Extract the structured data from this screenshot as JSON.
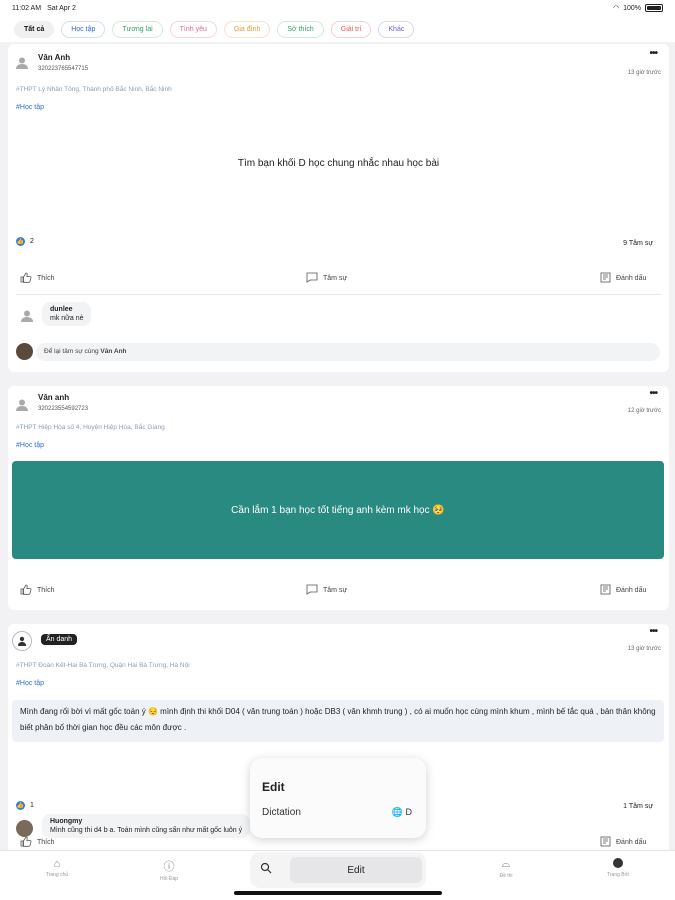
{
  "status_bar": {
    "time": "11:02 AM",
    "date": "Sat Apr 2",
    "battery": "100%"
  },
  "tabs": [
    {
      "label": "Tất cả",
      "color": "#111111",
      "border": "#f0f0f0"
    },
    {
      "label": "Học tập",
      "color": "#2f6fd8",
      "border": "#cfe0f7"
    },
    {
      "label": "Tương lai",
      "color": "#2e9f63",
      "border": "#cdeed9"
    },
    {
      "label": "Tình yêu",
      "color": "#e36b8a",
      "border": "#f6d5dd"
    },
    {
      "label": "Gia đình",
      "color": "#e39a3b",
      "border": "#f6e3c9"
    },
    {
      "label": "Sở thích",
      "color": "#2e9f63",
      "border": "#cdeed9"
    },
    {
      "label": "Giải trí",
      "color": "#e05a5a",
      "border": "#f6d0d0"
    },
    {
      "label": "Khác",
      "color": "#6a5ad8",
      "border": "#dcd7f6"
    }
  ],
  "posts": [
    {
      "name": "Vân Anh",
      "uid": "320223765547715",
      "time": "13 giờ trước",
      "school": "#THPT Lý Nhân Tông, Thành phố Bắc Ninh, Bắc Ninh",
      "tag": "#Học tập",
      "content": "Tìm bạn khối D học chung nhắc nhau học bài",
      "likes": "2",
      "shares": "9 Tâm sự",
      "comment_name": "dunlee",
      "comment_text": "mk nữa nè",
      "reply_placeholder": "Để lại tâm sự cùng",
      "reply_name": "Vân Anh"
    },
    {
      "name": "Vân anh",
      "uid": "320223554592723",
      "time": "12 giờ trước",
      "school": "#THPT Hiệp Hòa số 4, Huyện Hiệp Hòa, Bắc Giang",
      "tag": "#Học tập",
      "content": "Cần lắm 1 bạn học tốt tiếng anh kèm mk học 🥺",
      "box_color": "#288a80"
    },
    {
      "badge": "Ẩn danh",
      "time": "13 giờ trước",
      "school": "#THPT Đoàn Kết-Hai Bà Trưng, Quận Hai Bà Trưng, Hà Nội",
      "tag": "#Học tập",
      "content": "Mình đang rối bời vì mất gốc toán ý 😔 mình định thi khối D04 ( văn trung toán ) hoặc DB3 ( văn khmh trung ) , có ai muốn học cùng mình khum , mình bế tắc quá , bản thân không biết phân bố thời gian học đều các môn được .",
      "likes": "1",
      "shares": "1 Tâm sự",
      "comment_name": "Huongmy",
      "comment_text": "Mình cũng thi d4 b a. Toán mình cũng sẩn như mất gốc luôn ý"
    }
  ],
  "actions": {
    "like": "Thích",
    "comment": "Tâm sự",
    "bookmark": "Đánh dấu"
  },
  "bottom_nav": [
    {
      "label": "Trang chủ",
      "icon": "home-icon"
    },
    {
      "label": "Hỏi Đáp",
      "icon": "question-icon"
    },
    {
      "label": "",
      "icon": "hidden"
    },
    {
      "label": "",
      "icon": "hidden"
    },
    {
      "label": "Đề thi",
      "icon": "bag-icon"
    },
    {
      "label": "Trang Bởi",
      "icon": "profile-avatar"
    }
  ],
  "popup": {
    "title": "Edit",
    "dictation": "Dictation",
    "dictation_key": "🌐 D"
  },
  "edit_bar": {
    "button": "Edit"
  }
}
